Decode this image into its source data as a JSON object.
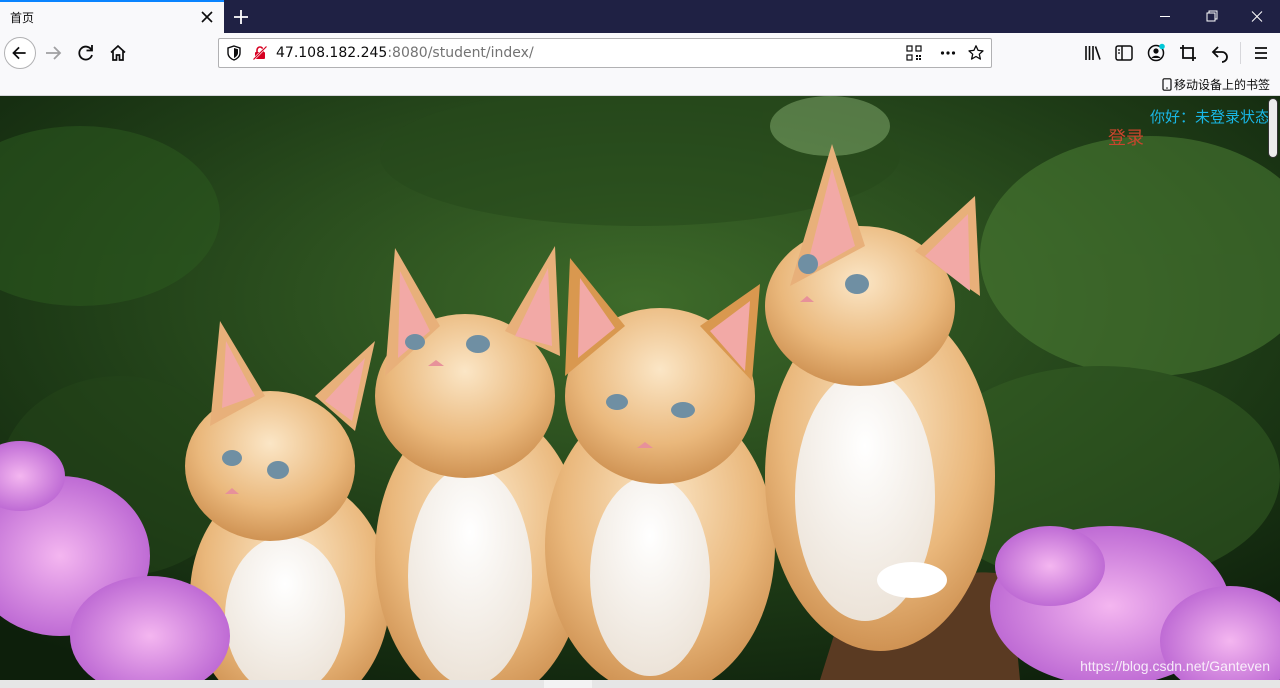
{
  "tab": {
    "title": "首页"
  },
  "address_bar": {
    "host": "47.108.182.245",
    "rest": ":8080/student/index/"
  },
  "bookmarks": {
    "mobile_label": "移动设备上的书签"
  },
  "page": {
    "greeting": "你好：未登录状态",
    "login": "登录",
    "watermark": "https://blog.csdn.net/Ganteven"
  },
  "colors": {
    "tabbar_bg": "#1f2144",
    "accent": "#0a84ff",
    "greeting": "#19b7e6",
    "login": "#c8452d"
  }
}
